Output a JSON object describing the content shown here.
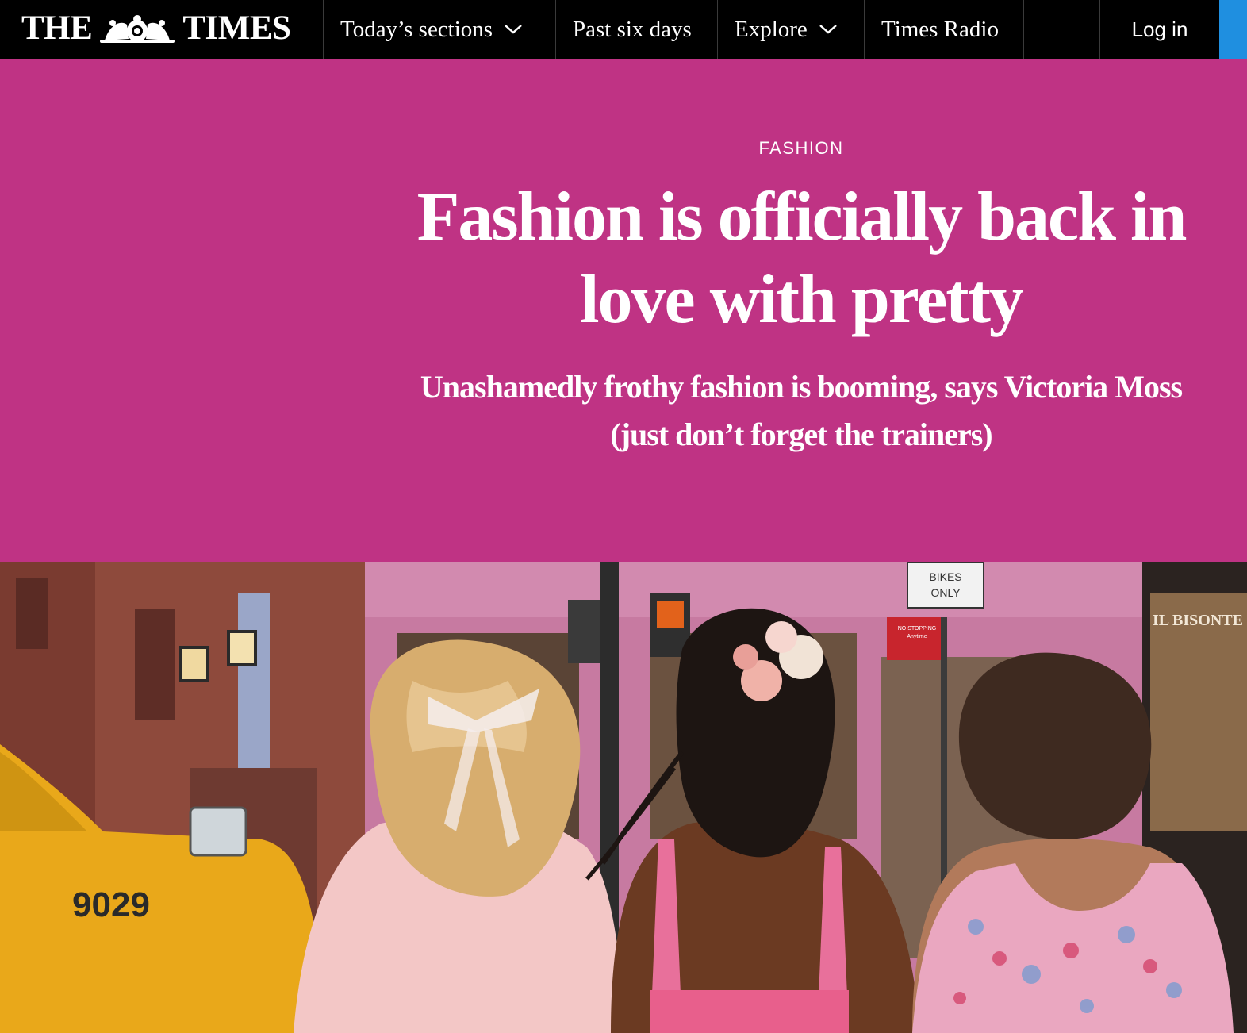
{
  "header": {
    "logo_left": "THE",
    "logo_right": "TIMES",
    "nav": [
      {
        "label": "Today’s sections",
        "has_dropdown": true
      },
      {
        "label": "Past six days",
        "has_dropdown": false
      },
      {
        "label": "Explore",
        "has_dropdown": true
      },
      {
        "label": "Times Radio",
        "has_dropdown": false
      }
    ],
    "login_label": "Log in"
  },
  "article": {
    "section": "FASHION",
    "headline": "Fashion is officially back in love with pretty",
    "standfirst": "Unashamedly frothy fashion is booming, says Victoria Moss (just don’t forget the trainers)"
  },
  "photo": {
    "taxi_number": "9029",
    "sign_bikes_line1": "BIKES",
    "sign_bikes_line2": "ONLY",
    "sign_no_stopping_line1": "NO STOPPING",
    "sign_no_stopping_line2": "Anytime",
    "shop_sign": "IL BISONTE"
  },
  "colors": {
    "topbar": "#000000",
    "hero_background": "#bf3384",
    "accent_blue": "#1f8fe0",
    "text": "#ffffff"
  },
  "icons": {
    "dropdown": "chevron-down-icon",
    "crest": "royal-crest-icon"
  }
}
